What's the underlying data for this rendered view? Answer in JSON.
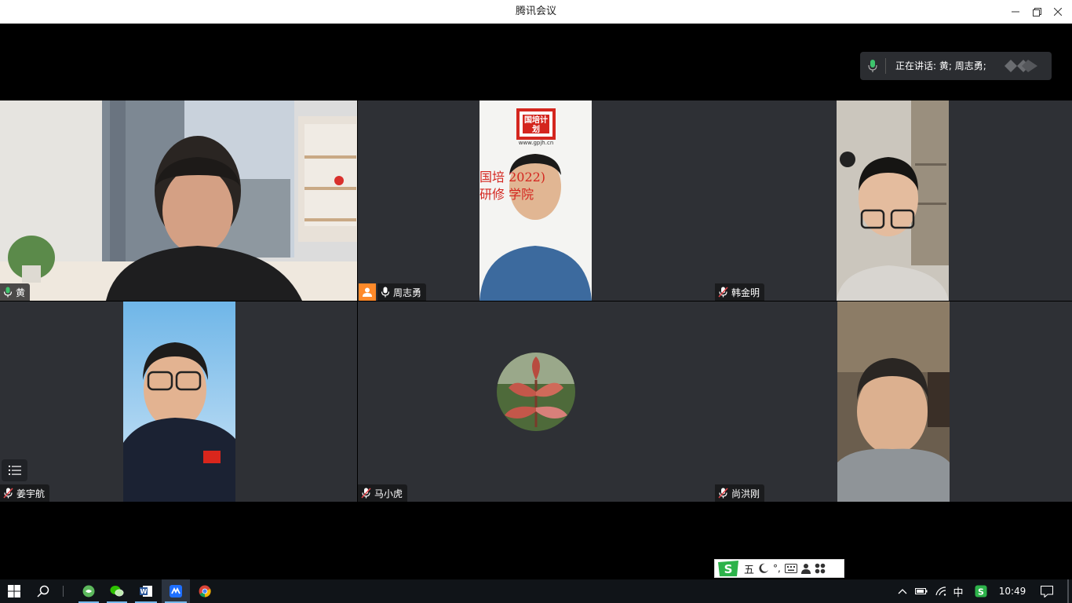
{
  "window": {
    "title": "腾讯会议",
    "minimize_icon": "minimize-icon",
    "restore_icon": "restore-icon",
    "close_icon": "close-icon"
  },
  "speaking_indicator": {
    "text": "正在讲话: 黄; 周志勇;",
    "icon": "mic-icon"
  },
  "participants": [
    {
      "name": "黄",
      "mic": "active",
      "video_on": true,
      "highlighted": true
    },
    {
      "name": "周志勇",
      "mic": "active",
      "video_on": true,
      "host": true,
      "banner_text_1": "国培  2022)",
      "banner_text_2": "研修      学院",
      "logo_text": "国培计划",
      "logo_url_text": "www.gpjh.cn"
    },
    {
      "name": "韩金明",
      "mic": "muted",
      "video_on": true
    },
    {
      "name": "姜宇航",
      "mic": "muted",
      "video_on": true
    },
    {
      "name": "马小虎",
      "mic": "muted",
      "video_on": false,
      "avatar": "plant-avatar"
    },
    {
      "name": "尚洪刚",
      "mic": "muted",
      "video_on": true
    }
  ],
  "participant_list_icon": "list-icon",
  "ime_bar": {
    "mode": "五",
    "icons": [
      "sogou-logo-icon",
      "moon-icon",
      "punctuation-icon",
      "keyboard-icon",
      "user-icon",
      "apps-icon"
    ],
    "punct": "°,"
  },
  "taskbar": {
    "apps": [
      "start-icon",
      "search-icon",
      "app-green-icon",
      "wechat-icon",
      "word-icon",
      "tencent-meeting-icon",
      "chrome-icon"
    ],
    "active_app": "tencent-meeting-icon",
    "tray": {
      "chevron": "^",
      "ime_label": "中",
      "time": "10:49"
    }
  },
  "colors": {
    "tile_bg": "#2e3035",
    "active_border": "#2fc45c",
    "host_badge": "#ff8a2a",
    "taskbar": "#101418"
  }
}
